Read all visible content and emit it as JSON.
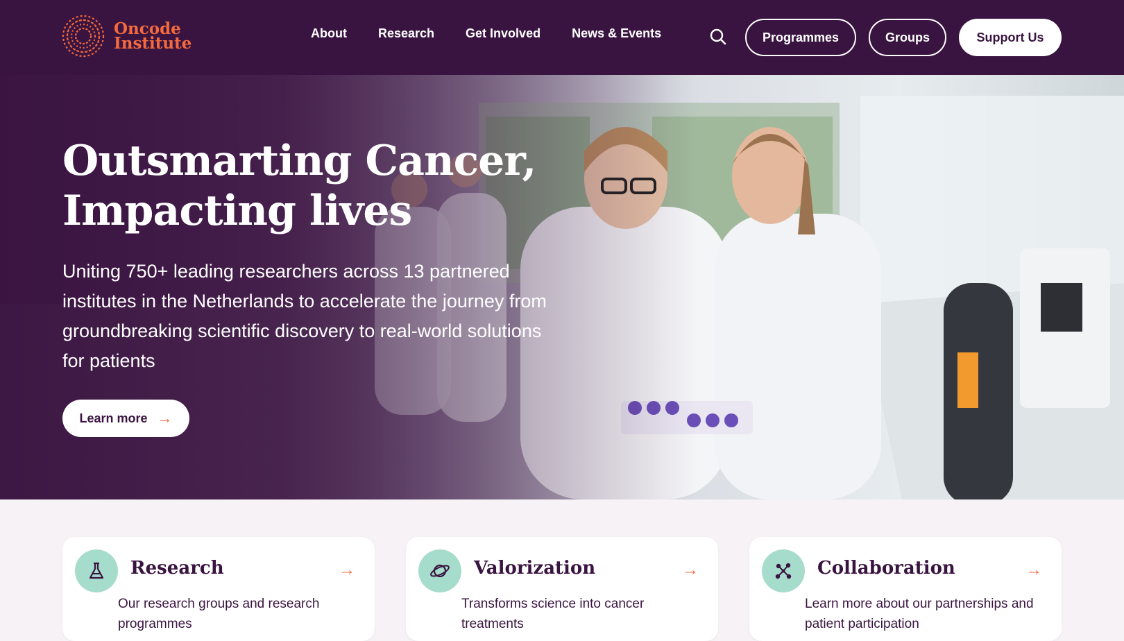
{
  "logo": {
    "line1": "Oncode",
    "line2": "Institute"
  },
  "nav": {
    "items": [
      {
        "label": "About"
      },
      {
        "label": "Research"
      },
      {
        "label": "Get Involved"
      },
      {
        "label": "News & Events"
      }
    ],
    "search_icon": "search-icon",
    "programmes_label": "Programmes",
    "groups_label": "Groups",
    "support_label": "Support Us"
  },
  "hero": {
    "title_line1": "Outsmarting Cancer,",
    "title_line2": "Impacting lives",
    "text": "Uniting 750+ leading researchers across 13 partnered institutes in the Netherlands to accelerate the journey from groundbreaking scientific discovery to real-world solutions for patients",
    "cta_label": "Learn more",
    "cta_icon": "arrow-right-icon"
  },
  "cards": [
    {
      "title": "Research",
      "description": "Our research groups and research programmes",
      "icon": "flask-icon"
    },
    {
      "title": "Valorization",
      "description": "Transforms science into cancer treatments",
      "icon": "planet-icon"
    },
    {
      "title": "Collaboration",
      "description": "Learn more about our partnerships and patient participation",
      "icon": "network-icon"
    }
  ],
  "colors": {
    "header_bg": "#3a1440",
    "accent": "#f26a3d",
    "icon_circle": "#a6dccb",
    "page_bg": "#f6f2f6"
  }
}
